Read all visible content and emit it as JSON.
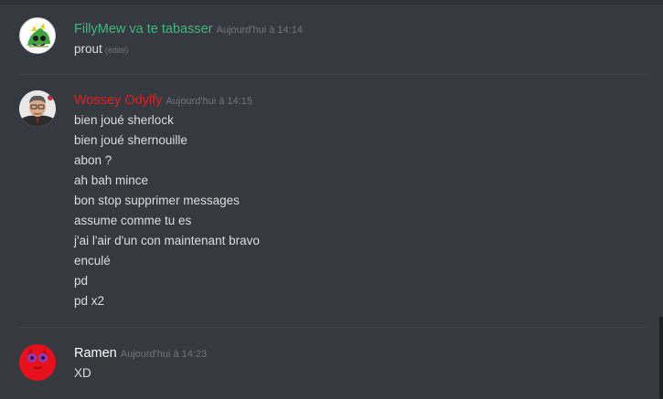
{
  "messages": [
    {
      "username": "FillyMew va te tabasser",
      "username_color": "#43b581",
      "timestamp": "Aujourd'hui à 14:14",
      "avatar_icon": "filly-cartoon-avatar",
      "lines": [
        "prout"
      ],
      "edited_label": "(édité)"
    },
    {
      "username": "Wossey Odylfy",
      "username_color": "#e02020",
      "timestamp": "Aujourd'hui à 14:15",
      "avatar_icon": "man-photo-avatar",
      "lines": [
        "bien joué sherlock",
        "bien joué shernouille",
        "abon ?",
        "ah bah mince",
        "bon stop supprimer messages",
        "assume comme tu es",
        "j'ai l'air d'un con maintenant bravo",
        "enculé",
        "pd",
        "pd x2"
      ]
    },
    {
      "username": "Ramen",
      "username_color": "#ffffff",
      "timestamp": "Aujourd'hui à 14:23",
      "avatar_icon": "red-cat-avatar",
      "lines": [
        "XD"
      ]
    }
  ]
}
